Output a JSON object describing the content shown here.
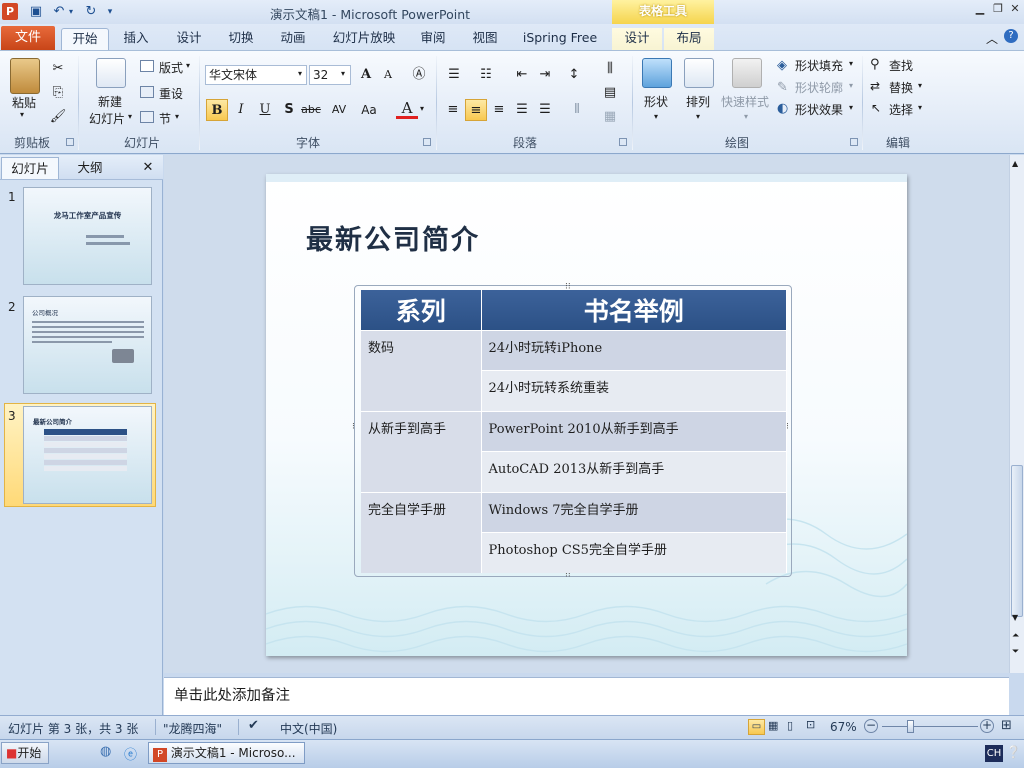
{
  "app": {
    "icon_letter": "P",
    "title": "演示文稿1 - Microsoft PowerPoint",
    "context_tools": "表格工具"
  },
  "tabs": [
    "文件",
    "开始",
    "插入",
    "设计",
    "切换",
    "动画",
    "幻灯片放映",
    "审阅",
    "视图",
    "iSpring Free",
    "设计",
    "布局"
  ],
  "active_tab": "开始",
  "ribbon": {
    "clipboard": {
      "label": "剪贴板",
      "paste": "粘贴"
    },
    "slides": {
      "label": "幻灯片",
      "new_slide_line1": "新建",
      "new_slide_line2": "幻灯片",
      "layout": "版式",
      "reset": "重设",
      "section": "节"
    },
    "font": {
      "label": "字体",
      "font_name": "华文宋体",
      "font_size": "32",
      "bold": "B",
      "italic": "I",
      "underline": "U",
      "shadow": "S",
      "strike": "abc",
      "spacing": "AV",
      "case": "Aa",
      "color": "A",
      "grow": "A",
      "shrink": "A"
    },
    "paragraph": {
      "label": "段落"
    },
    "drawing": {
      "label": "绘图",
      "shapes": "形状",
      "arrange": "排列",
      "quick_styles": "快速样式",
      "fill": "形状填充",
      "outline": "形状轮廓",
      "effects": "形状效果"
    },
    "editing": {
      "label": "编辑",
      "find": "查找",
      "replace": "替换",
      "select": "选择"
    }
  },
  "left_panel": {
    "tab_slides": "幻灯片",
    "tab_outline": "大纲",
    "close": "✕",
    "thumbs": [
      {
        "num": "1",
        "title": "龙马工作室产品宣传"
      },
      {
        "num": "2",
        "title": "公司概况"
      },
      {
        "num": "3",
        "title": "最新公司简介"
      }
    ]
  },
  "slide": {
    "title": "最新公司简介",
    "table": {
      "headers": [
        "系列",
        "书名举例"
      ],
      "rows": [
        {
          "series": "数码",
          "book": "24小时玩转iPhone"
        },
        {
          "series": "",
          "book": "24小时玩转系统重装"
        },
        {
          "series": "从新手到高手",
          "book": "PowerPoint 2010从新手到高手"
        },
        {
          "series": "",
          "book": "AutoCAD 2013从新手到高手"
        },
        {
          "series": "完全自学手册",
          "book": "Windows 7完全自学手册"
        },
        {
          "series": "",
          "book": "Photoshop CS5完全自学手册"
        }
      ]
    }
  },
  "notes_placeholder": "单击此处添加备注",
  "status": {
    "slide_info": "幻灯片 第 3 张，共 3 张",
    "theme": "\"龙腾四海\"",
    "language": "中文(中国)",
    "zoom": "67%"
  },
  "taskbar": {
    "start": "开始",
    "task": "演示文稿1 - Microso...",
    "ime": "CH"
  },
  "colors": {
    "file_tab": "#d24726",
    "table_header": "#2c5186",
    "context_tools": "#f5d44d"
  }
}
